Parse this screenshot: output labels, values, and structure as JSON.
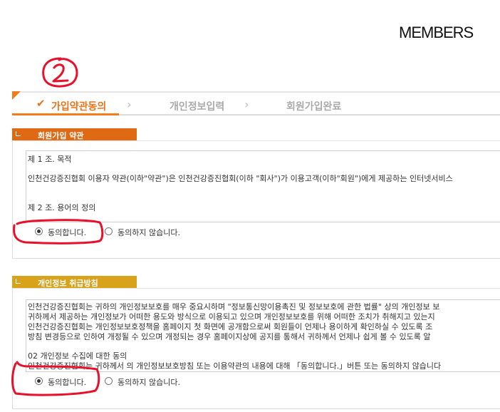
{
  "header": {
    "title": "MEMBERS"
  },
  "steps": [
    {
      "label": "가입약관동의",
      "active": true
    },
    {
      "label": "개인정보입력",
      "active": false
    },
    {
      "label": "회원가입완료",
      "active": false
    }
  ],
  "terms": {
    "heading": "회원가입 약관",
    "heading_color": "#e06a14",
    "lines": [
      "제 1 조. 목적",
      "인천건강증진협회 이용자 약관(이하\"약관\")은 인천건강증진협회(이하 \"회사\")가 이용고객(이하\"회원\")에게 제공하는 인터넷서비스",
      "제 2 조. 용어의 정의"
    ],
    "agree": "동의합니다.",
    "disagree": "동의하지 않습니다.",
    "selected": "agree"
  },
  "privacy": {
    "heading": "개인정보 취급방침",
    "heading_color": "#d8a21a",
    "lines": [
      "인천건강증진협회는 귀하의 개인정보보호를 매우 중요시하며 \"정보통신망이용촉진 및 정보보호에 관한 법률\" 상의 개인정보 보",
      "귀하께서 제공하는 개인정보가 어떠한 용도와 방식으로 이용되고 있으며 개인정보보호를 위해 어떠한 조치가 취해지고 있는지",
      "인천건강증진협회는 개인정보보호정책을 홈페이지 첫 화면에 공개함으로써 회원들이 언제나 용이하게 확인하실 수 있도록 조",
      "방침 변경등으로 인하여 개정될 수 있으며 개정되는 경우 홈페이지상에 공지를 통해서 귀하께서 언제나 쉽게 볼 수 있도록 알",
      "02 개인정보 수집에 대한 동의",
      "인천건강증진협회는 귀하께서 의 개인정보보호방침 또는 이용약관의 내용에 대해 「동의합니다.」버튼 또는 동의하지 않습니다"
    ],
    "agree": "동의합니다.",
    "disagree": "동의하지 않습니다.",
    "selected": "agree"
  },
  "colors": {
    "accent": "#f07d1a",
    "annotation": "#e8102a"
  }
}
